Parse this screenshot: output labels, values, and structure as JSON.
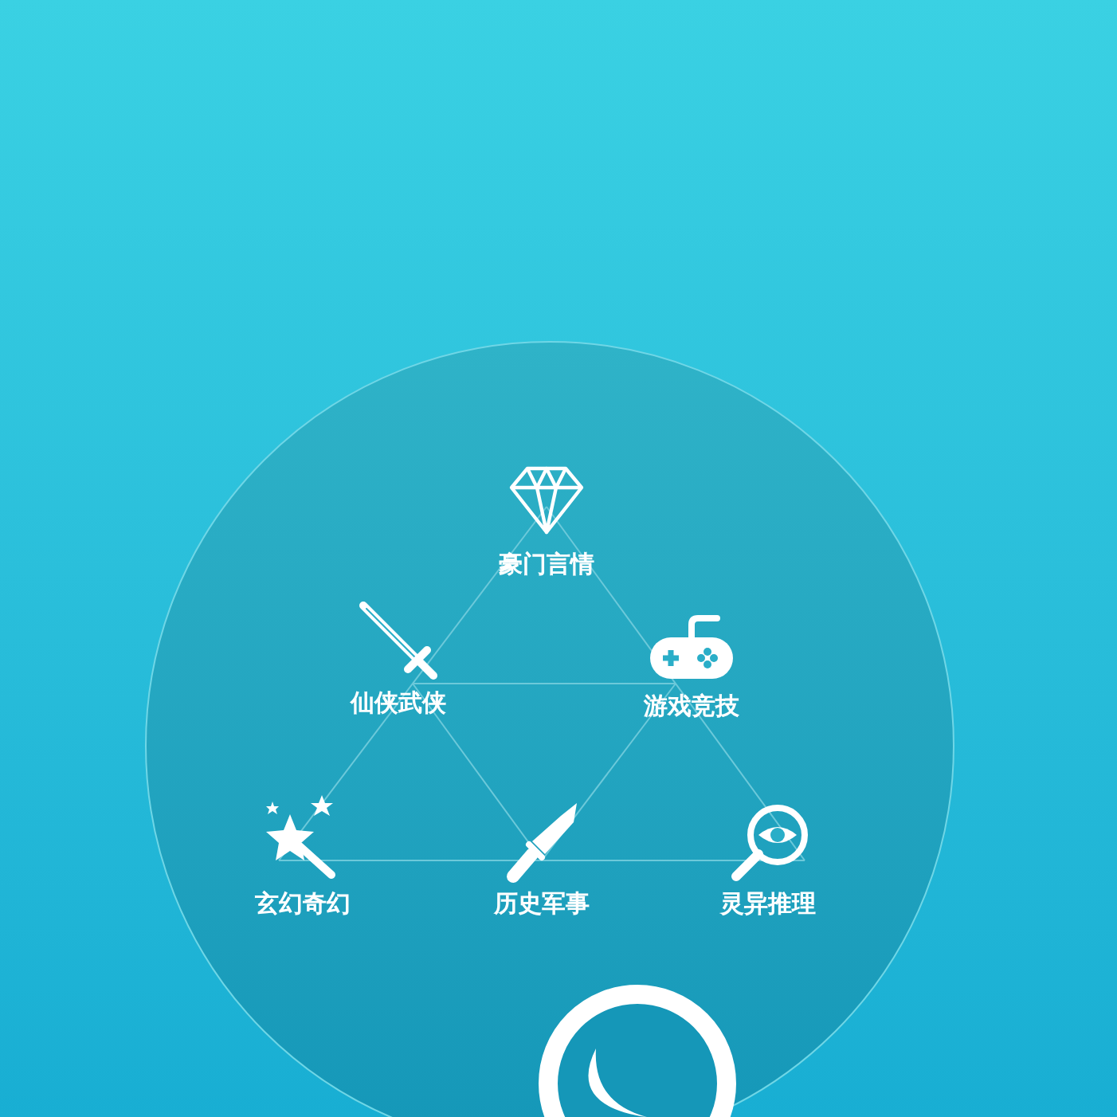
{
  "categories": [
    {
      "kind": "diamond",
      "label": "豪门言情"
    },
    {
      "kind": "sword",
      "label": "仙侠武侠"
    },
    {
      "kind": "gamepad",
      "label": "游戏竞技"
    },
    {
      "kind": "wand",
      "label": "玄幻奇幻"
    },
    {
      "kind": "knife",
      "label": "历史军事"
    },
    {
      "kind": "eye",
      "label": "灵异推理"
    }
  ]
}
